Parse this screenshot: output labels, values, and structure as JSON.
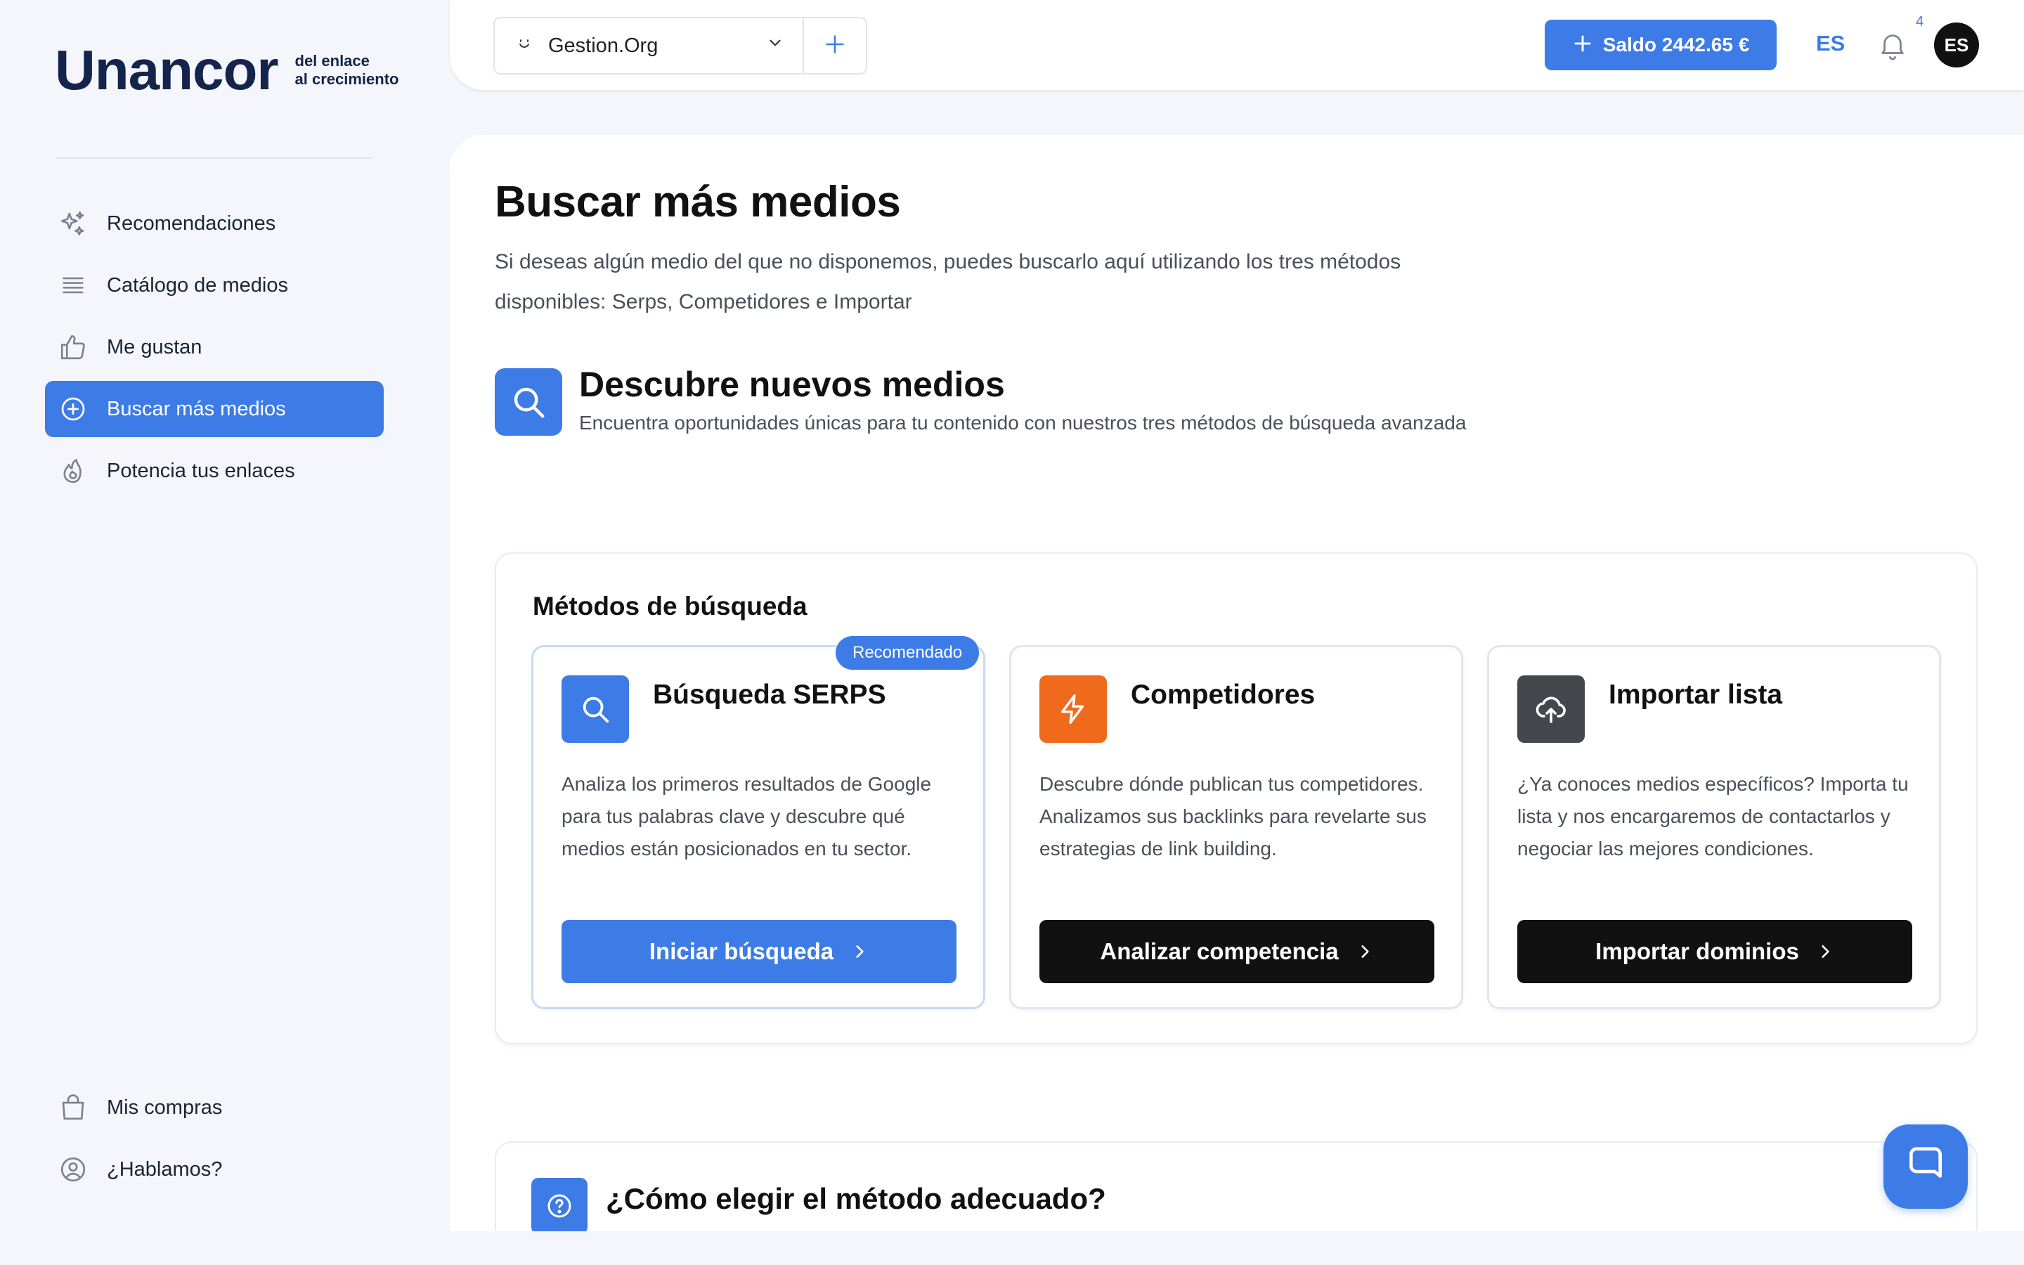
{
  "brand": {
    "logo_text": "Unancor",
    "tagline_line1": "del enlace",
    "tagline_line2": "al crecimiento"
  },
  "sidebar": {
    "items": [
      {
        "label": "Recomendaciones",
        "icon": "sparkles-icon"
      },
      {
        "label": "Catálogo de medios",
        "icon": "list-icon"
      },
      {
        "label": "Me gustan",
        "icon": "thumbs-up-icon"
      },
      {
        "label": "Buscar más medios",
        "icon": "plus-circle-icon",
        "active": true
      },
      {
        "label": "Potencia tus enlaces",
        "icon": "flame-icon"
      }
    ],
    "bottom_items": [
      {
        "label": "Mis compras",
        "icon": "shopping-bag-icon"
      },
      {
        "label": "¿Hablamos?",
        "icon": "user-circle-icon"
      }
    ]
  },
  "topbar": {
    "org_name": "Gestion.Org",
    "saldo_label": "Saldo 2442.65 €",
    "language": "ES",
    "notifications_count": "4",
    "avatar_initials": "ES"
  },
  "main": {
    "title": "Buscar más medios",
    "description": "Si deseas algún medio del que no disponemos, puedes buscarlo aquí utilizando los tres métodos disponibles: Serps, Competidores e Importar",
    "discover_title": "Descubre nuevos medios",
    "discover_subtitle": "Encuentra oportunidades únicas para tu contenido con nuestros tres métodos de búsqueda avanzada",
    "methods_title": "Métodos de búsqueda",
    "methods": [
      {
        "title": "Búsqueda SERPS",
        "badge": "Recomendado",
        "description": "Analiza los primeros resultados de Google para tus palabras clave y descubre qué medios están posicionados en tu sector.",
        "button": "Iniciar búsqueda",
        "icon": "search-icon",
        "icon_color": "#3d7be6",
        "button_color": "#3d7be6"
      },
      {
        "title": "Competidores",
        "description": "Descubre dónde publican tus competidores. Analizamos sus backlinks para revelarte sus estrategias de link building.",
        "button": "Analizar competencia",
        "icon": "lightning-icon",
        "icon_color": "#f06a1d",
        "button_color": "#111111"
      },
      {
        "title": "Importar lista",
        "description": "¿Ya conoces medios específicos? Importa tu lista y nos encargaremos de contactarlos y negociar las mejores condiciones.",
        "button": "Importar dominios",
        "icon": "cloud-upload-icon",
        "icon_color": "#45474d",
        "button_color": "#111111"
      }
    ],
    "howto_title": "¿Cómo elegir el método adecuado?"
  },
  "colors": {
    "accent": "#3d7be6",
    "dark": "#111111",
    "brand_navy": "#14254b"
  }
}
